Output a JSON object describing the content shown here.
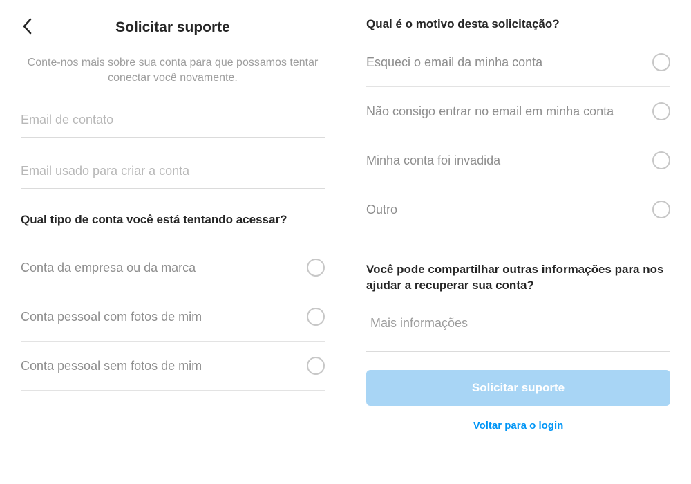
{
  "header": {
    "title": "Solicitar suporte",
    "subtitle": "Conte-nos mais sobre sua conta para que possamos tentar conectar você novamente."
  },
  "inputs": {
    "contactEmailPlaceholder": "Email de contato",
    "signupEmailPlaceholder": "Email usado para criar a conta",
    "moreInfoPlaceholder": "Mais informações"
  },
  "sections": {
    "accountTypeHeading": "Qual tipo de conta você está tentando acessar?",
    "reasonHeading": "Qual é o motivo desta solicitação?",
    "moreInfoHeading": "Você pode compartilhar outras informações para nos ajudar a recuperar sua conta?"
  },
  "accountTypes": [
    "Conta da empresa ou da marca",
    "Conta pessoal com fotos de mim",
    "Conta pessoal sem fotos de mim"
  ],
  "reasons": [
    "Esqueci o email da minha conta",
    "Não consigo entrar no email em minha conta",
    "Minha conta foi invadida",
    "Outro"
  ],
  "buttons": {
    "submit": "Solicitar suporte",
    "backToLogin": "Voltar para o login"
  }
}
